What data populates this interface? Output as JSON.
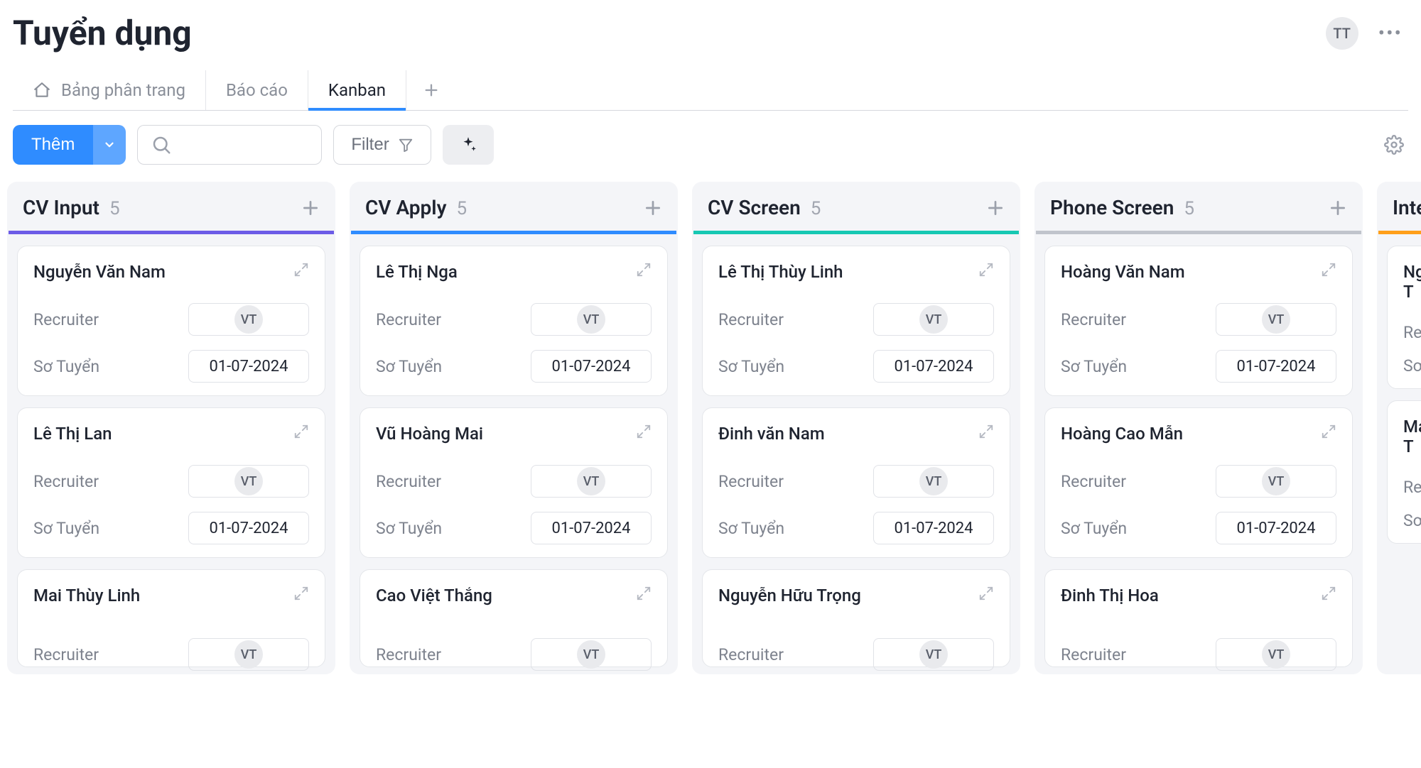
{
  "header": {
    "page_title": "Tuyển dụng",
    "user_initials": "TT"
  },
  "tabs": {
    "items": [
      {
        "label": "Bảng phân trang"
      },
      {
        "label": "Báo cáo"
      },
      {
        "label": "Kanban"
      }
    ],
    "active_index": 2
  },
  "toolbar": {
    "add_label": "Thêm",
    "filter_label": "Filter"
  },
  "field_labels": {
    "recruiter": "Recruiter",
    "so_tuyen": "Sơ Tuyển"
  },
  "columns": [
    {
      "title": "CV Input",
      "count": 5,
      "accent": "purple",
      "cards": [
        {
          "name": "Nguyễn Văn Nam",
          "recruiter_initials": "VT",
          "so_tuyen": "01-07-2024"
        },
        {
          "name": "Lê Thị Lan",
          "recruiter_initials": "VT",
          "so_tuyen": "01-07-2024"
        },
        {
          "name": "Mai Thùy Linh",
          "recruiter_initials": "VT",
          "so_tuyen": "",
          "partial": true
        }
      ]
    },
    {
      "title": "CV Apply",
      "count": 5,
      "accent": "blue",
      "cards": [
        {
          "name": "Lê Thị Nga",
          "recruiter_initials": "VT",
          "so_tuyen": "01-07-2024"
        },
        {
          "name": "Vũ Hoàng Mai",
          "recruiter_initials": "VT",
          "so_tuyen": "01-07-2024"
        },
        {
          "name": "Cao Việt Thắng",
          "recruiter_initials": "VT",
          "so_tuyen": "",
          "partial": true
        }
      ]
    },
    {
      "title": "CV Screen",
      "count": 5,
      "accent": "teal",
      "cards": [
        {
          "name": "Lê Thị Thùy Linh",
          "recruiter_initials": "VT",
          "so_tuyen": "01-07-2024"
        },
        {
          "name": "Đinh văn Nam",
          "recruiter_initials": "VT",
          "so_tuyen": "01-07-2024"
        },
        {
          "name": "Nguyễn Hữu Trọng",
          "recruiter_initials": "VT",
          "so_tuyen": "",
          "partial": true
        }
      ]
    },
    {
      "title": "Phone Screen",
      "count": 5,
      "accent": "gray",
      "cards": [
        {
          "name": "Hoàng Văn Nam",
          "recruiter_initials": "VT",
          "so_tuyen": "01-07-2024"
        },
        {
          "name": "Hoàng Cao Mẫn",
          "recruiter_initials": "VT",
          "so_tuyen": "01-07-2024"
        },
        {
          "name": "Đinh Thị Hoa",
          "recruiter_initials": "VT",
          "so_tuyen": "",
          "partial": true
        }
      ]
    },
    {
      "title": "Interv",
      "count": "",
      "accent": "orange",
      "truncated": true,
      "cards": [
        {
          "name": "Ngô T",
          "recruiter_label_only": true
        },
        {
          "name": "Mai T",
          "recruiter_label_only": true
        }
      ]
    }
  ]
}
